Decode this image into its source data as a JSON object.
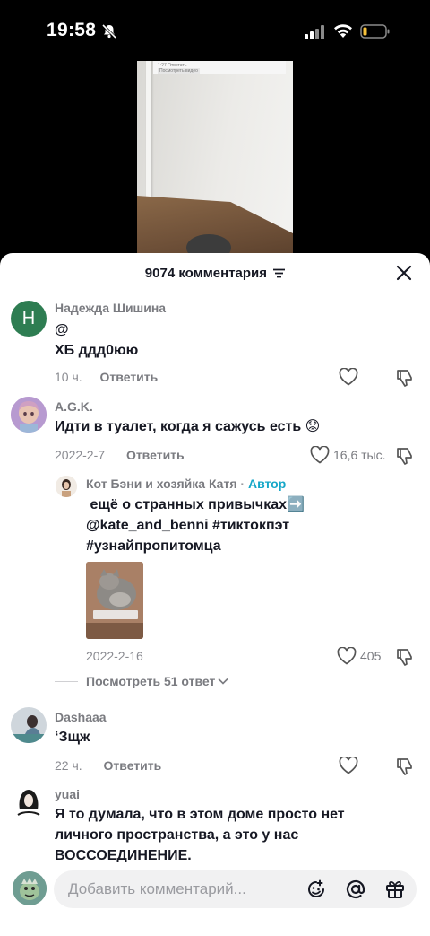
{
  "status_bar": {
    "time": "19:58"
  },
  "video": {
    "overlay_text_1": "1:27  Ответить",
    "overlay_text_2": "Посмотреть видео"
  },
  "sheet": {
    "title": "9074 комментария",
    "comments": [
      {
        "author": "Надежда Шишина",
        "avatar_letter": "Н",
        "avatar_color": "#2e7d52",
        "text_line1": "@",
        "text_line2": "ХБ ддд0юю",
        "time": "10 ч.",
        "reply_label": "Ответить"
      },
      {
        "author": "A.G.K.",
        "text": "Идти в туалет, когда я сажусь есть 😟",
        "time": "2022-2-7",
        "reply_label": "Ответить",
        "likes": "16,6 тыс."
      },
      {
        "author": "Кот Бэни и хозяйка Катя",
        "badge": "Автор",
        "text_line1": "ещё о странных привычках➡️",
        "text_line2": "@kate_and_benni #тиктокпэт",
        "text_line3": "#узнайпропитомца",
        "time": "2022-2-16",
        "likes": "405"
      },
      {
        "author": "Dashaaa",
        "text": "‘Зщж",
        "time": "22 ч.",
        "reply_label": "Ответить"
      },
      {
        "author": "yuai",
        "text_line1": "Я то думала, что в этом доме просто нет",
        "text_line2": "личного пространства, а это у нас",
        "text_line3": "ВОССОЕДИНЕНИЕ."
      }
    ],
    "view_replies": "Посмотреть 51 ответ"
  },
  "input": {
    "placeholder": "Добавить комментарий..."
  },
  "colors": {
    "author_badge": "#16a7c8",
    "sheet_bg": "#ffffff",
    "input_bg": "#f1f1f2"
  }
}
